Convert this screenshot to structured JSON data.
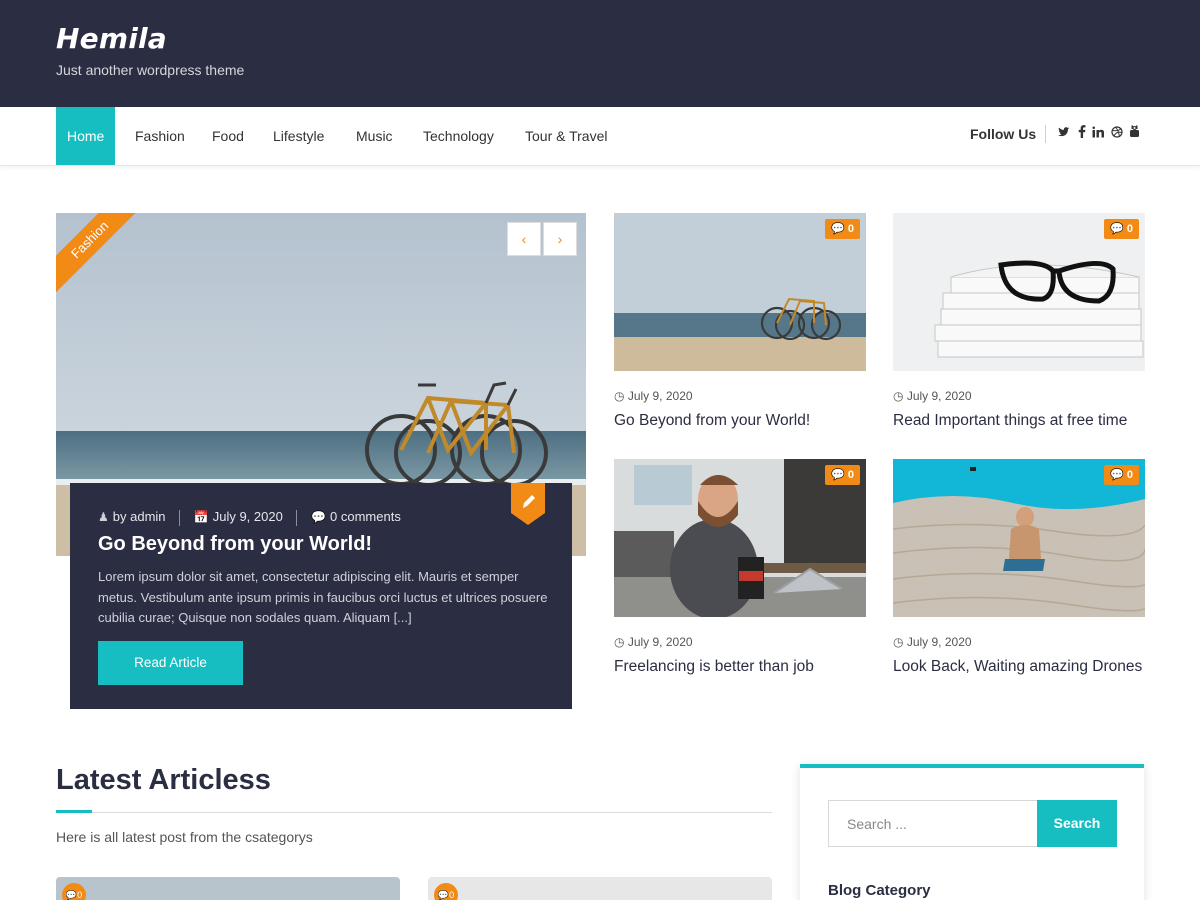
{
  "header": {
    "site_title": "Hemila",
    "tagline": "Just another wordpress theme"
  },
  "nav": {
    "items": [
      {
        "label": "Home",
        "active": true
      },
      {
        "label": "Fashion"
      },
      {
        "label": "Food"
      },
      {
        "label": "Lifestyle"
      },
      {
        "label": "Music"
      },
      {
        "label": "Technology"
      },
      {
        "label": "Tour & Travel"
      }
    ],
    "follow_label": "Follow Us",
    "social_icons": [
      "twitter-icon",
      "facebook-icon",
      "linkedin-icon",
      "dribbble-icon",
      "youtube-icon"
    ]
  },
  "hero": {
    "category": "Fashion",
    "prev_arrow": "‹",
    "next_arrow": "›",
    "author": "by admin",
    "date": "July 9, 2020",
    "comments": "0 comments",
    "title": "Go Beyond from your World!",
    "excerpt": "Lorem ipsum dolor sit amet, consectetur adipiscing elit. Mauris et semper metus. Vestibulum ante ipsum primis in faucibus orci luctus et ultrices posuere cubilia curae; Quisque non sodales quam. Aliquam [...]",
    "button_label": "Read Article"
  },
  "cards": [
    {
      "comments": "0",
      "date": "July 9, 2020",
      "title": "Go Beyond from your World!"
    },
    {
      "comments": "0",
      "date": "July 9, 2020",
      "title": "Read Important things at free time"
    },
    {
      "comments": "0",
      "date": "July 9, 2020",
      "title": "Freelancing is better than job"
    },
    {
      "comments": "0",
      "date": "July 9, 2020",
      "title": "Look Back, Waiting amazing Drones"
    }
  ],
  "latest": {
    "title": "Latest Articless",
    "subtitle": "Here is all latest post from the csategorys",
    "badge_counts": [
      "0",
      "0"
    ]
  },
  "sidebar": {
    "search_placeholder": "Search ...",
    "search_button": "Search",
    "widget_title": "Blog Category"
  },
  "colors": {
    "header_bg": "#2b2d42",
    "accent": "#16bec1",
    "orange": "#f28a16"
  }
}
